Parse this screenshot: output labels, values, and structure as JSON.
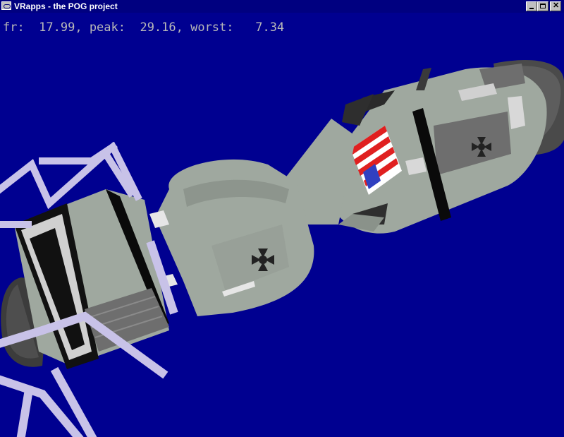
{
  "window": {
    "title": "VRapps - the POG project",
    "app_icon": "vrapps-app-icon",
    "controls": {
      "minimize_icon": "minimize-icon",
      "maximize_icon": "maximize-icon",
      "close_icon": "close-icon",
      "close_glyph": "✕"
    }
  },
  "stats": {
    "text": "fr:  17.99, peak:  29.16, worst:   7.34"
  },
  "scene": {
    "background_color": "#000090",
    "hull_color": "#9fa89f",
    "lander_leg_color": "#c8c2e8"
  }
}
